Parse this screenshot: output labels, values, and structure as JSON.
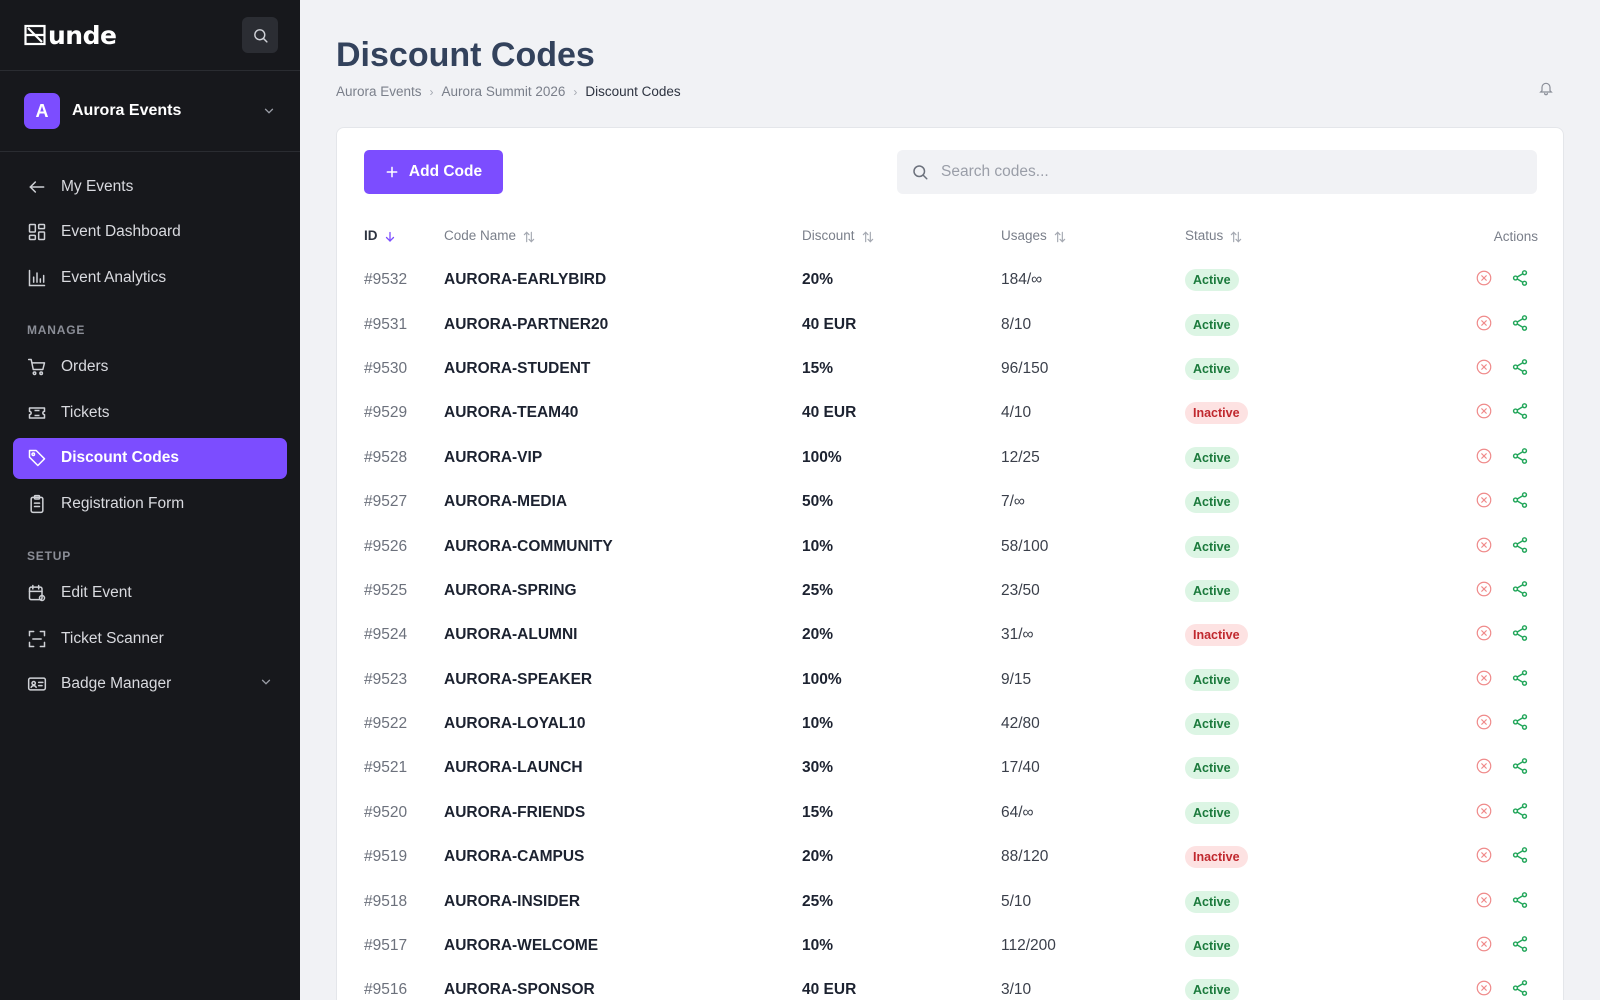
{
  "brand": {
    "logo_text": "unde"
  },
  "org": {
    "initial": "A",
    "name": "Aurora Events"
  },
  "sidebar": {
    "top_items": [
      {
        "label": "My Events",
        "icon": "arrow-left-icon"
      },
      {
        "label": "Event Dashboard",
        "icon": "dashboard-icon"
      },
      {
        "label": "Event Analytics",
        "icon": "analytics-icon"
      }
    ],
    "manage_title": "MANAGE",
    "manage_items": [
      {
        "label": "Orders",
        "icon": "cart-icon"
      },
      {
        "label": "Tickets",
        "icon": "ticket-icon"
      },
      {
        "label": "Discount Codes",
        "icon": "tag-icon",
        "active": true
      },
      {
        "label": "Registration Form",
        "icon": "clipboard-icon"
      }
    ],
    "setup_title": "SETUP",
    "setup_items": [
      {
        "label": "Edit Event",
        "icon": "calendar-gear-icon"
      },
      {
        "label": "Ticket Scanner",
        "icon": "scan-icon"
      },
      {
        "label": "Badge Manager",
        "icon": "badge-icon",
        "has_submenu": true
      }
    ]
  },
  "header": {
    "title": "Discount Codes",
    "breadcrumb": [
      "Aurora Events",
      "Aurora Summit 2026",
      "Discount Codes"
    ]
  },
  "toolbar": {
    "add_label": "Add Code",
    "search_placeholder": "Search codes..."
  },
  "table": {
    "columns": [
      "ID",
      "Code Name",
      "Discount",
      "Usages",
      "Status",
      "Actions"
    ],
    "rows": [
      {
        "id": "#9532",
        "name": "AURORA-EARLYBIRD",
        "discount": "20%",
        "usages": "184/∞",
        "status": "Active"
      },
      {
        "id": "#9531",
        "name": "AURORA-PARTNER20",
        "discount": "40 EUR",
        "usages": "8/10",
        "status": "Active"
      },
      {
        "id": "#9530",
        "name": "AURORA-STUDENT",
        "discount": "15%",
        "usages": "96/150",
        "status": "Active"
      },
      {
        "id": "#9529",
        "name": "AURORA-TEAM40",
        "discount": "40 EUR",
        "usages": "4/10",
        "status": "Inactive"
      },
      {
        "id": "#9528",
        "name": "AURORA-VIP",
        "discount": "100%",
        "usages": "12/25",
        "status": "Active"
      },
      {
        "id": "#9527",
        "name": "AURORA-MEDIA",
        "discount": "50%",
        "usages": "7/∞",
        "status": "Active"
      },
      {
        "id": "#9526",
        "name": "AURORA-COMMUNITY",
        "discount": "10%",
        "usages": "58/100",
        "status": "Active"
      },
      {
        "id": "#9525",
        "name": "AURORA-SPRING",
        "discount": "25%",
        "usages": "23/50",
        "status": "Active"
      },
      {
        "id": "#9524",
        "name": "AURORA-ALUMNI",
        "discount": "20%",
        "usages": "31/∞",
        "status": "Inactive"
      },
      {
        "id": "#9523",
        "name": "AURORA-SPEAKER",
        "discount": "100%",
        "usages": "9/15",
        "status": "Active"
      },
      {
        "id": "#9522",
        "name": "AURORA-LOYAL10",
        "discount": "10%",
        "usages": "42/80",
        "status": "Active"
      },
      {
        "id": "#9521",
        "name": "AURORA-LAUNCH",
        "discount": "30%",
        "usages": "17/40",
        "status": "Active"
      },
      {
        "id": "#9520",
        "name": "AURORA-FRIENDS",
        "discount": "15%",
        "usages": "64/∞",
        "status": "Active"
      },
      {
        "id": "#9519",
        "name": "AURORA-CAMPUS",
        "discount": "20%",
        "usages": "88/120",
        "status": "Inactive"
      },
      {
        "id": "#9518",
        "name": "AURORA-INSIDER",
        "discount": "25%",
        "usages": "5/10",
        "status": "Active"
      },
      {
        "id": "#9517",
        "name": "AURORA-WELCOME",
        "discount": "10%",
        "usages": "112/200",
        "status": "Active"
      },
      {
        "id": "#9516",
        "name": "AURORA-SPONSOR",
        "discount": "40 EUR",
        "usages": "3/10",
        "status": "Active"
      }
    ]
  },
  "colors": {
    "accent": "#7c4dff",
    "sidebar_bg": "#17181c",
    "active_badge": "#1b7a3c",
    "inactive_badge": "#c0282e"
  }
}
